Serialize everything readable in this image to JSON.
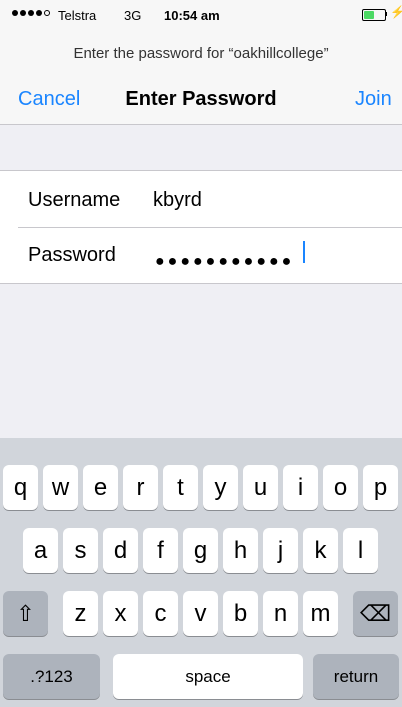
{
  "status_bar": {
    "carrier": "Telstra",
    "network": "3G",
    "time": "10:54 am"
  },
  "nav": {
    "prompt": "Enter the password for “oakhillcollege”",
    "cancel_label": "Cancel",
    "title": "Enter Password",
    "join_label": "Join"
  },
  "form": {
    "username_label": "Username",
    "username_value": "kbyrd",
    "password_label": "Password",
    "password_mask": "●●●●●●●●●●●"
  },
  "keyboard": {
    "row1": [
      "q",
      "w",
      "e",
      "r",
      "t",
      "y",
      "u",
      "i",
      "o",
      "p"
    ],
    "row2": [
      "a",
      "s",
      "d",
      "f",
      "g",
      "h",
      "j",
      "k",
      "l"
    ],
    "row3": [
      "z",
      "x",
      "c",
      "v",
      "b",
      "n",
      "m"
    ],
    "shift_icon": "⇧",
    "delete_icon": "⌫",
    "numbers_label": ".?123",
    "space_label": "space",
    "return_label": "return"
  },
  "colors": {
    "accent": "#1a85ff",
    "battery": "#4cd964"
  }
}
